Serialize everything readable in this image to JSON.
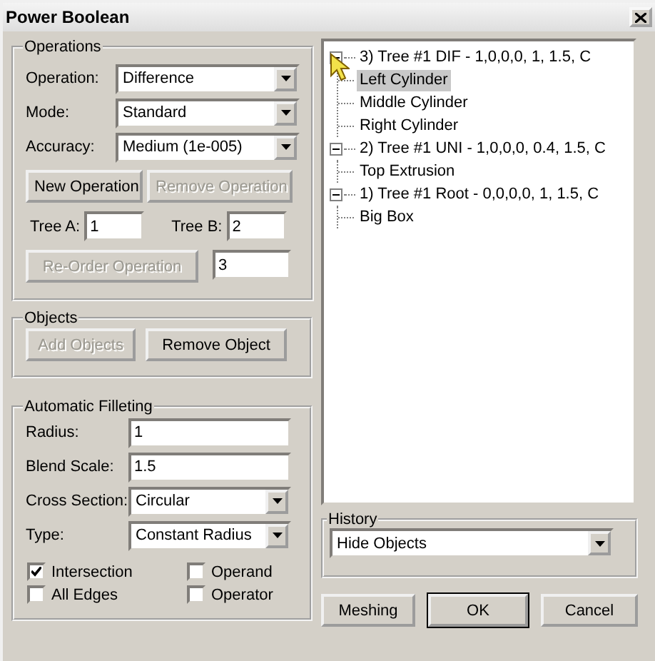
{
  "window": {
    "title": "Power Boolean"
  },
  "operations": {
    "title": "Operations",
    "fields": [
      {
        "label": "Operation:",
        "value": "Difference"
      },
      {
        "label": "Mode:",
        "value": "Standard"
      },
      {
        "label": "Accuracy:",
        "value": "Medium (1e-005)"
      }
    ],
    "buttons": [
      {
        "label": "New Operation",
        "disabled": false
      },
      {
        "label": "Remove Operation",
        "disabled": true
      }
    ],
    "tree_a": {
      "label": "Tree A:",
      "value": "1"
    },
    "tree_b": {
      "label": "Tree B:",
      "value": "2"
    },
    "reorder": {
      "label": "Re-Order Operation",
      "disabled": true
    },
    "reorder_value": "3"
  },
  "objects": {
    "title": "Objects",
    "buttons": [
      {
        "label": "Add Objects",
        "disabled": true
      },
      {
        "label": "Remove Object",
        "disabled": false
      }
    ]
  },
  "filleting": {
    "title": "Automatic Filleting",
    "fields": [
      {
        "kind": "text",
        "label": "Radius:",
        "value": "1"
      },
      {
        "kind": "text",
        "label": "Blend Scale:",
        "value": "1.5"
      },
      {
        "kind": "combo",
        "label": "Cross Section:",
        "value": "Circular"
      },
      {
        "kind": "combo",
        "label": "Type:",
        "value": "Constant Radius"
      }
    ],
    "checkboxes": [
      {
        "label": "Intersection",
        "checked": true
      },
      {
        "label": "Operand",
        "checked": false
      },
      {
        "label": "All Edges",
        "checked": false
      },
      {
        "label": "Operator",
        "checked": false
      }
    ]
  },
  "tree": [
    {
      "label": "3) Tree #1 DIF  - 1,0,0,0, 1, 1.5, C",
      "expanded": true,
      "selected": false,
      "children": [
        {
          "label": "Left Cylinder",
          "selected": true
        },
        {
          "label": "Middle Cylinder",
          "selected": false
        },
        {
          "label": "Right Cylinder",
          "selected": false
        }
      ]
    },
    {
      "label": "2) Tree #1 UNI  - 1,0,0,0, 0.4, 1.5, C",
      "expanded": true,
      "selected": false,
      "children": [
        {
          "label": "Top Extrusion",
          "selected": false
        }
      ]
    },
    {
      "label": "1) Tree #1 Root - 0,0,0,0, 1, 1.5, C",
      "expanded": true,
      "selected": false,
      "children": [
        {
          "label": "Big Box",
          "selected": false
        }
      ]
    }
  ],
  "history": {
    "title": "History",
    "value": "Hide Objects"
  },
  "buttons": [
    {
      "label": "Meshing",
      "default": false
    },
    {
      "label": "OK",
      "default": true
    },
    {
      "label": "Cancel",
      "default": false
    }
  ]
}
